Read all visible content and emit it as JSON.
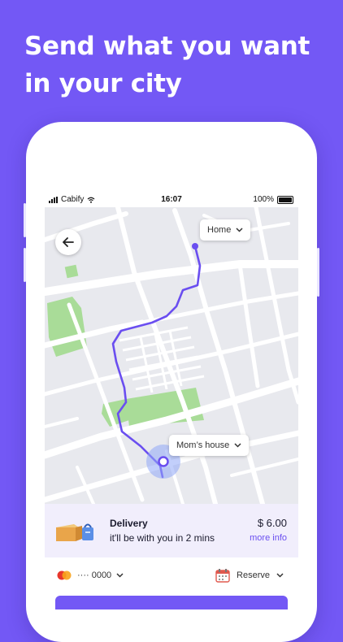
{
  "headline": "Send what you want in your city",
  "status_bar": {
    "carrier": "Cabify",
    "time": "16:07",
    "battery": "100%"
  },
  "map": {
    "pickup_label": "Home",
    "dropoff_label": "Mom’s house",
    "route_color": "#6a4ef0"
  },
  "delivery": {
    "title": "Delivery",
    "eta": "it'll be with you in 2 mins",
    "price": "$ 6.00",
    "more_info": "more info"
  },
  "payment": {
    "card_masked": "···· 0000",
    "reserve_label": "Reserve"
  },
  "colors": {
    "brand": "#7358f5",
    "panel": "#f1eefc",
    "accent": "#6a4ef0"
  }
}
